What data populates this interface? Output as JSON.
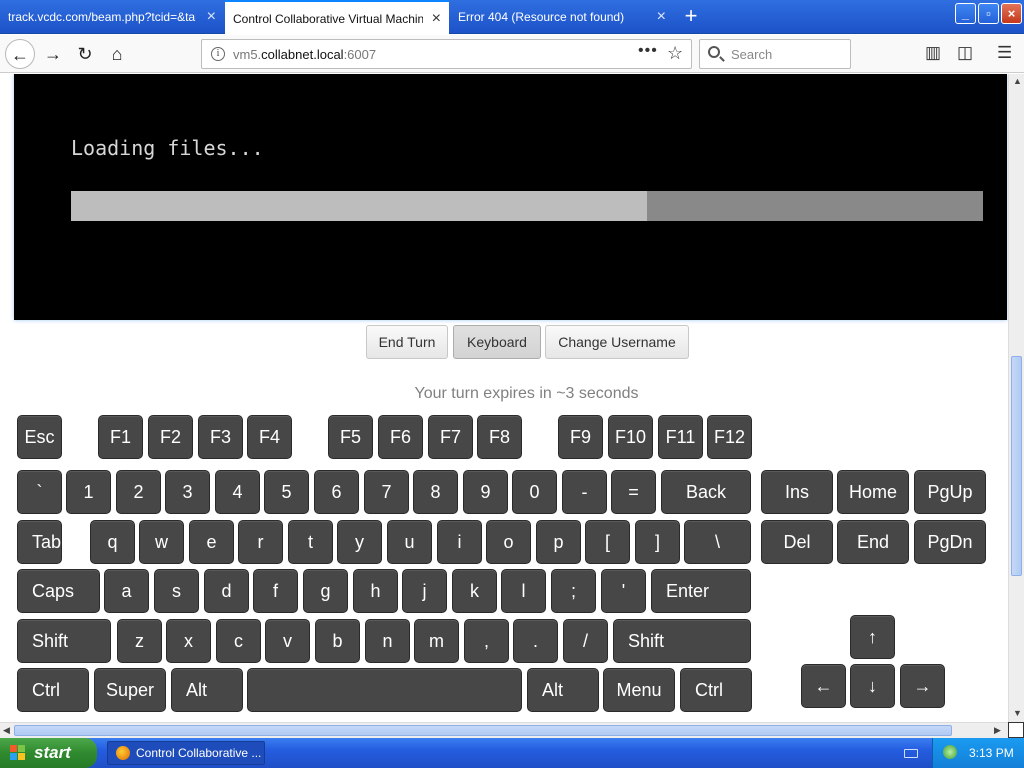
{
  "browser": {
    "tabs": [
      {
        "title": "track.vcdc.com/beam.php?tcid=&targ",
        "active": false
      },
      {
        "title": "Control Collaborative Virtual Machines!",
        "active": true
      },
      {
        "title": "Error 404 (Resource not found)",
        "active": false
      }
    ],
    "address": {
      "host_dim": "vm5.",
      "host_bold": "collabnet.local",
      "port": ":6007"
    },
    "search_placeholder": "Search"
  },
  "vm_screen": {
    "loading_text": "Loading files...",
    "progress": 0.632
  },
  "controls": {
    "end_turn": "End Turn",
    "keyboard": "Keyboard",
    "change_username": "Change Username"
  },
  "turn_status": "Your turn expires in ~3 seconds",
  "keyboard": {
    "function_row": [
      "Esc",
      "F1",
      "F2",
      "F3",
      "F4",
      "F5",
      "F6",
      "F7",
      "F8",
      "F9",
      "F10",
      "F11",
      "F12"
    ],
    "number_row": [
      "`",
      "1",
      "2",
      "3",
      "4",
      "5",
      "6",
      "7",
      "8",
      "9",
      "0",
      "-",
      "=",
      "Back"
    ],
    "top_row": [
      "Tab",
      "q",
      "w",
      "e",
      "r",
      "t",
      "y",
      "u",
      "i",
      "o",
      "p",
      "[",
      "]",
      "\\"
    ],
    "home_row": [
      "Caps",
      "a",
      "s",
      "d",
      "f",
      "g",
      "h",
      "j",
      "k",
      "l",
      ";",
      "'",
      "Enter"
    ],
    "bottom_row": [
      "Shift",
      "z",
      "x",
      "c",
      "v",
      "b",
      "n",
      "m",
      ",",
      ".",
      "/",
      "Shift"
    ],
    "space_row": [
      "Ctrl",
      "Super",
      "Alt",
      "",
      "Alt",
      "Menu",
      "Ctrl"
    ],
    "nav_keys": [
      "Ins",
      "Home",
      "PgUp",
      "Del",
      "End",
      "PgDn"
    ],
    "arrows": [
      "↑",
      "←",
      "↓",
      "→"
    ]
  },
  "taskbar": {
    "start": "start",
    "task": "Control Collaborative ...",
    "clock": "3:13 PM"
  },
  "colors": {
    "key_bg": "#474747",
    "taskbar": "#245de0",
    "start": "#2f8a2f"
  }
}
